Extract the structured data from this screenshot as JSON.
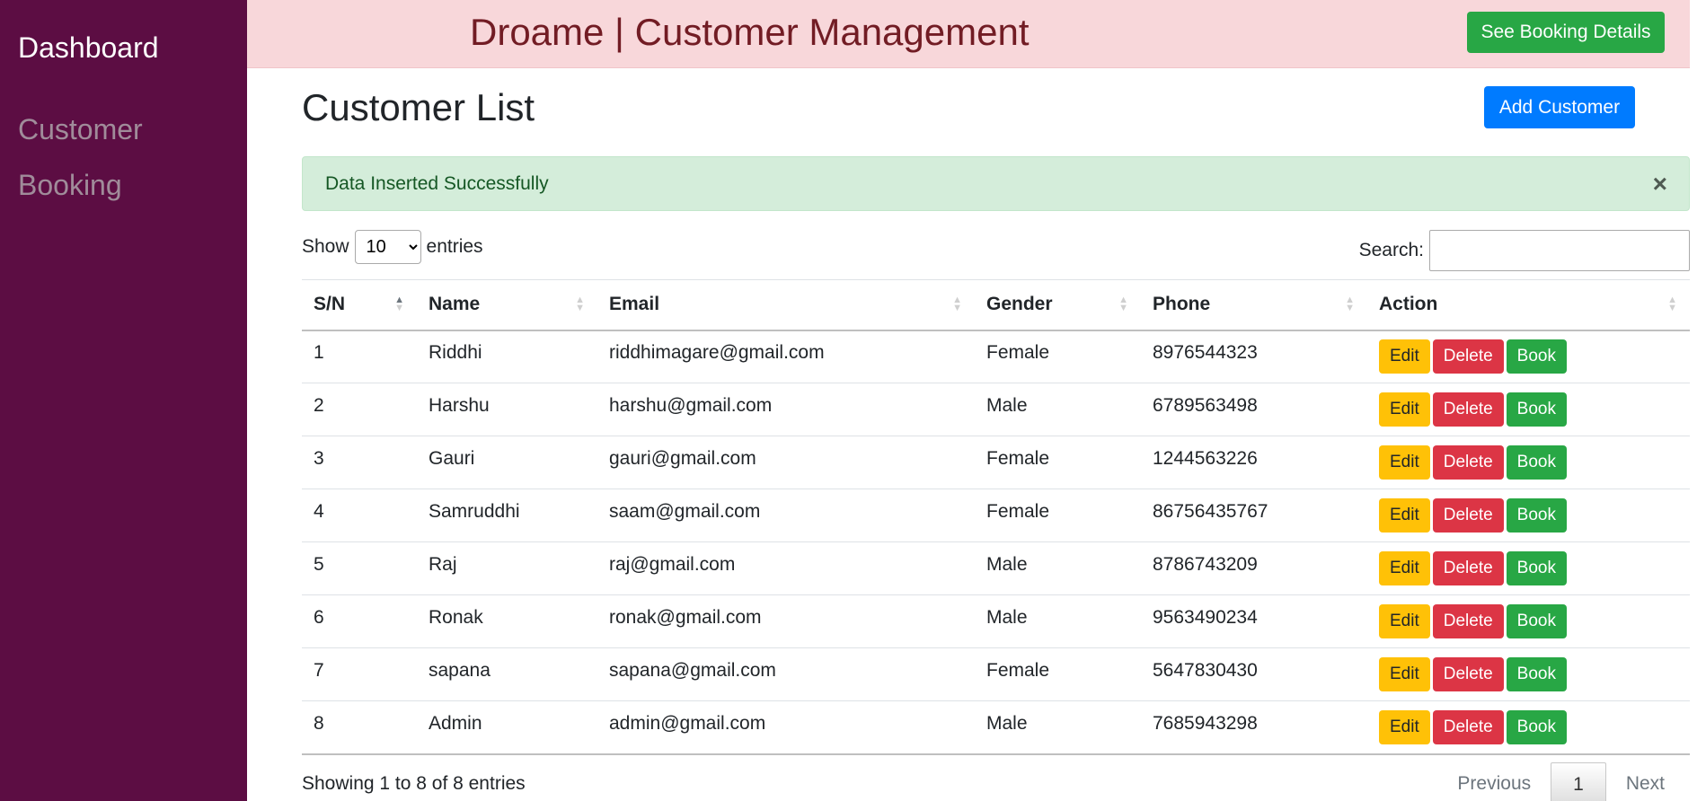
{
  "sidebar": {
    "brand": "Dashboard",
    "items": [
      {
        "label": "Customer"
      },
      {
        "label": "Booking"
      }
    ]
  },
  "header": {
    "title": "Droame | Customer Management",
    "booking_button": "See Booking Details"
  },
  "page": {
    "title": "Customer List",
    "add_button": "Add Customer"
  },
  "alert": {
    "message": "Data Inserted Successfully",
    "close_symbol": "×"
  },
  "table_controls": {
    "show_label": "Show",
    "entries_label": "entries",
    "page_size": "10",
    "search_label": "Search:",
    "search_value": ""
  },
  "table": {
    "columns": [
      "S/N",
      "Name",
      "Email",
      "Gender",
      "Phone",
      "Action"
    ],
    "actions": {
      "edit": "Edit",
      "delete": "Delete",
      "book": "Book"
    },
    "rows": [
      {
        "sn": "1",
        "name": "Riddhi",
        "email": "riddhimagare@gmail.com",
        "gender": "Female",
        "phone": "8976544323"
      },
      {
        "sn": "2",
        "name": "Harshu",
        "email": "harshu@gmail.com",
        "gender": "Male",
        "phone": "6789563498"
      },
      {
        "sn": "3",
        "name": "Gauri",
        "email": "gauri@gmail.com",
        "gender": "Female",
        "phone": "1244563226"
      },
      {
        "sn": "4",
        "name": "Samruddhi",
        "email": "saam@gmail.com",
        "gender": "Female",
        "phone": "86756435767"
      },
      {
        "sn": "5",
        "name": "Raj",
        "email": "raj@gmail.com",
        "gender": "Male",
        "phone": "8786743209"
      },
      {
        "sn": "6",
        "name": "Ronak",
        "email": "ronak@gmail.com",
        "gender": "Male",
        "phone": "9563490234"
      },
      {
        "sn": "7",
        "name": "sapana",
        "email": "sapana@gmail.com",
        "gender": "Female",
        "phone": "5647830430"
      },
      {
        "sn": "8",
        "name": "Admin",
        "email": "admin@gmail.com",
        "gender": "Male",
        "phone": "7685943298"
      }
    ]
  },
  "footer": {
    "info": "Showing 1 to 8 of 8 entries",
    "previous": "Previous",
    "current_page": "1",
    "next": "Next"
  },
  "colors": {
    "sidebar_bg": "#5c0d43",
    "header_bg": "#f8d7da",
    "header_text": "#721c24",
    "success": "#28a745",
    "primary": "#007bff",
    "warning": "#ffc107",
    "danger": "#dc3545",
    "alert_bg": "#d4edda"
  }
}
